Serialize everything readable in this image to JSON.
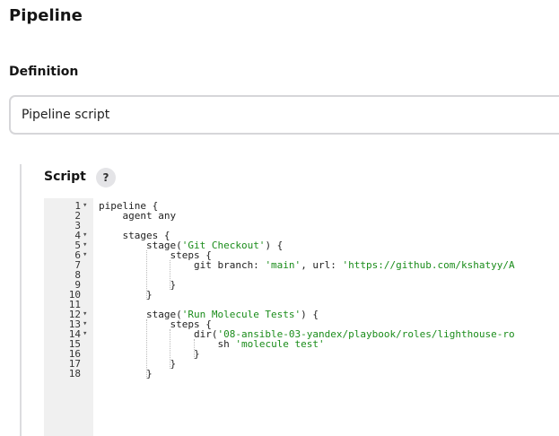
{
  "pipeline": {
    "title": "Pipeline",
    "definition_label": "Definition",
    "definition_value": "Pipeline script",
    "script_label": "Script",
    "help_icon_glyph": "?"
  },
  "editor": {
    "lines": [
      {
        "n": "1",
        "fold": true,
        "segments": [
          {
            "t": "pipeline {"
          }
        ]
      },
      {
        "n": "2",
        "fold": false,
        "segments": [
          {
            "t": "    agent any"
          }
        ]
      },
      {
        "n": "3",
        "fold": false,
        "segments": [
          {
            "t": ""
          }
        ]
      },
      {
        "n": "4",
        "fold": true,
        "segments": [
          {
            "t": "    stages {"
          }
        ]
      },
      {
        "n": "5",
        "fold": true,
        "segments": [
          {
            "t": "        stage("
          },
          {
            "t": "'Git Checkout'",
            "s": true
          },
          {
            "t": ") {"
          }
        ]
      },
      {
        "n": "6",
        "fold": true,
        "segments": [
          {
            "t": "            steps {"
          }
        ]
      },
      {
        "n": "7",
        "fold": false,
        "segments": [
          {
            "t": "                git branch: "
          },
          {
            "t": "'main'",
            "s": true
          },
          {
            "t": ", url: "
          },
          {
            "t": "'https://github.com/kshatyy/A",
            "s": true
          }
        ]
      },
      {
        "n": "8",
        "fold": false,
        "segments": [
          {
            "t": ""
          }
        ]
      },
      {
        "n": "9",
        "fold": false,
        "segments": [
          {
            "t": "            }"
          }
        ]
      },
      {
        "n": "10",
        "fold": false,
        "segments": [
          {
            "t": "        }"
          }
        ]
      },
      {
        "n": "11",
        "fold": false,
        "segments": [
          {
            "t": ""
          }
        ]
      },
      {
        "n": "12",
        "fold": true,
        "segments": [
          {
            "t": "        stage("
          },
          {
            "t": "'Run Molecule Tests'",
            "s": true
          },
          {
            "t": ") {"
          }
        ]
      },
      {
        "n": "13",
        "fold": true,
        "segments": [
          {
            "t": "            steps {"
          }
        ]
      },
      {
        "n": "14",
        "fold": true,
        "segments": [
          {
            "t": "                dir("
          },
          {
            "t": "'08-ansible-03-yandex/playbook/roles/lighthouse-ro",
            "s": true
          }
        ]
      },
      {
        "n": "15",
        "fold": false,
        "segments": [
          {
            "t": "                    sh "
          },
          {
            "t": "'molecule test'",
            "s": true
          }
        ]
      },
      {
        "n": "16",
        "fold": false,
        "segments": [
          {
            "t": "                }"
          }
        ]
      },
      {
        "n": "17",
        "fold": false,
        "segments": [
          {
            "t": "            }"
          }
        ]
      },
      {
        "n": "18",
        "fold": false,
        "segments": [
          {
            "t": "        }"
          }
        ]
      }
    ],
    "fold_glyph": "▾"
  }
}
